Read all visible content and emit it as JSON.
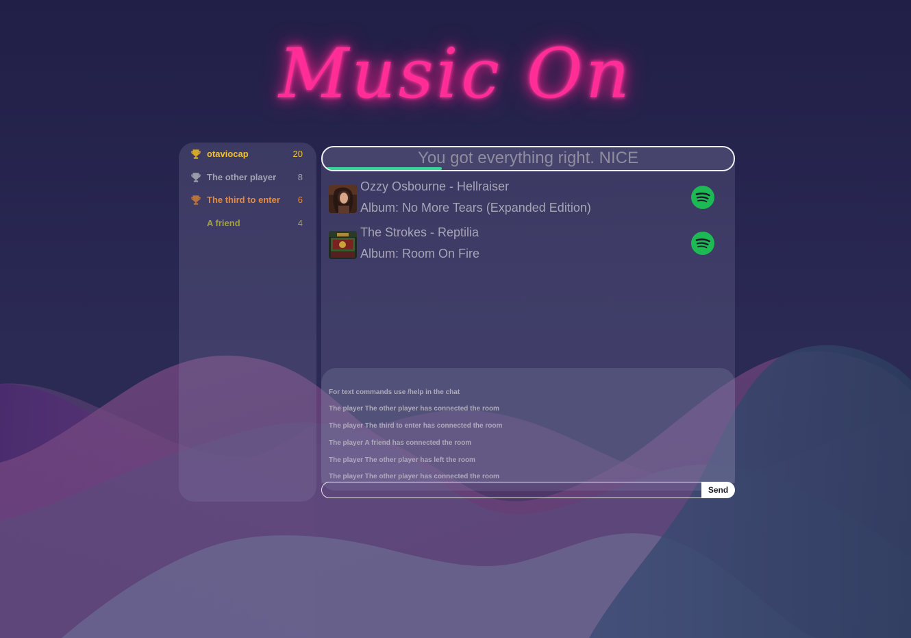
{
  "app": {
    "logo_text": "Music On"
  },
  "scoreboard": {
    "players": [
      {
        "name": "otaviocap",
        "score": "20",
        "trophy": "gold-trophy-icon",
        "color": "#f2c230"
      },
      {
        "name": "The other player",
        "score": "8",
        "trophy": "silver-trophy-icon",
        "color": "#a3a3b3"
      },
      {
        "name": "The third to enter",
        "score": "6",
        "trophy": "bronze-trophy-icon",
        "color": "#e88a3b"
      },
      {
        "name": "A friend",
        "score": "4",
        "trophy": "",
        "color": "#a1a03a"
      }
    ]
  },
  "status": {
    "message": "You got everything right. NICE",
    "progress": 0.29,
    "progress_color": "#37d99b"
  },
  "songs": [
    {
      "title": "Ozzy Osbourne - Hellraiser",
      "album": "Album: No More Tears (Expanded Edition)",
      "link_icon": "spotify-icon"
    },
    {
      "title": "The Strokes - Reptilia",
      "album": "Album: Room On Fire",
      "link_icon": "spotify-icon"
    }
  ],
  "chat": {
    "messages": [
      "For text commands use /help in the chat",
      "The player The other player has connected the room",
      "The player The third to enter has connected the room",
      "The player A friend has connected the room",
      "The player The other player has left the room",
      "The player The other player has connected the room"
    ],
    "input_value": "",
    "send_label": "Send"
  },
  "colors": {
    "logo_neon": "#ff2d95",
    "spotify_green": "#1db954",
    "background": "#22204a"
  }
}
